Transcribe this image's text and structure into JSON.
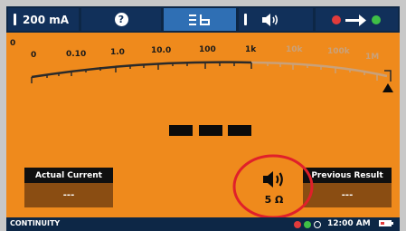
{
  "topbar": {
    "current_label": "200 mA",
    "help_glyph": "?",
    "mode_glyph": "☰□",
    "beeper_glyph": "◀))"
  },
  "scale": {
    "top_labels": [
      "0",
      "0.10",
      "1.0",
      "10.0",
      "100",
      "1k",
      "10k",
      "100k",
      "1M"
    ],
    "bottom_labels": [
      "0"
    ]
  },
  "reading": {
    "display": "- - -"
  },
  "panels": {
    "actual_current": {
      "title": "Actual Current",
      "value": "---"
    },
    "previous_result": {
      "title": "Previous Result",
      "value": "---"
    }
  },
  "beeper": {
    "threshold": "5 Ω"
  },
  "status": {
    "mode_label": "CONTINUITY",
    "time": "12:00 AM"
  },
  "colors": {
    "screen_bg": "#ef8a1c",
    "bar_bg": "#0d2746",
    "selected_tab": "#2f6fb4",
    "status_red": "#e23b3b",
    "status_green": "#3fc046",
    "highlight_circle": "#e0202a"
  },
  "icons": [
    "probe-icon",
    "help-icon",
    "range-icon",
    "beeper-icon",
    "lead-compensation-icon",
    "battery-icon",
    "speaker-icon"
  ]
}
